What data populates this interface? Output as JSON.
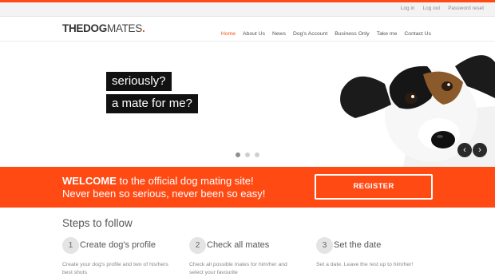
{
  "topbar": {
    "links": [
      "Log in",
      "Log out",
      "Password reset"
    ]
  },
  "header": {
    "logo": {
      "bold": "THEDOG",
      "light": "MATES",
      "dot": "."
    },
    "nav": [
      "Home",
      "About Us",
      "News",
      "Dog's Account",
      "Business Only",
      "Take me",
      "Contact Us"
    ],
    "active_nav": "Home"
  },
  "hero": {
    "lines": [
      "seriously?",
      "a mate for me?"
    ],
    "slides": 3,
    "active_slide": 1,
    "prev_icon": "chevron-left-icon",
    "next_icon": "chevron-right-icon"
  },
  "welcome": {
    "highlight": "WELCOME",
    "line1_rest": " to the official dog mating site!",
    "line2": "Never been so serious, never been so easy!",
    "register_label": "REGISTER"
  },
  "steps": {
    "title": "Steps to follow",
    "items": [
      {
        "num": "1",
        "title": "Create dog's profile",
        "desc": "Create your dog's profile and two of his/hers best shots"
      },
      {
        "num": "2",
        "title": "Check all mates",
        "desc": "Check all possible mates for him/her and select your favourite"
      },
      {
        "num": "3",
        "title": "Set the date",
        "desc": "Set a date.  Leave the rest up to him/her!"
      }
    ]
  },
  "colors": {
    "accent": "#ff4a14",
    "dark": "#111111"
  }
}
